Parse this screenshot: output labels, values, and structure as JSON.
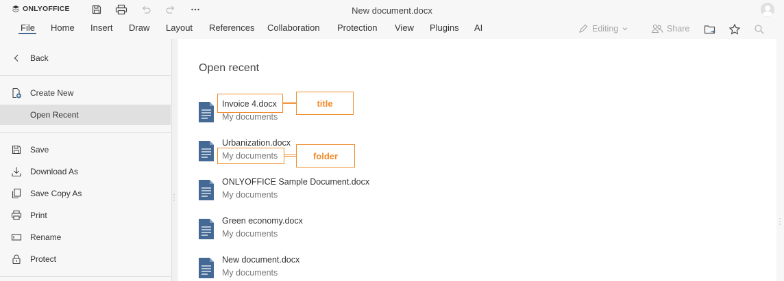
{
  "app": {
    "logo_text": "ONLYOFFICE",
    "document_title": "New document.docx"
  },
  "quick_access": {
    "icons": [
      "save-icon",
      "print-icon",
      "undo-icon",
      "redo-icon",
      "more-icon"
    ]
  },
  "menu": {
    "tabs": [
      "File",
      "Home",
      "Insert",
      "Draw",
      "Layout",
      "References",
      "Collaboration",
      "Protection",
      "View",
      "Plugins",
      "AI"
    ],
    "active_tab": "File",
    "editing_label": "Editing",
    "share_label": "Share"
  },
  "sidebar": {
    "items": [
      {
        "label": "Back",
        "icon": "chevron-left-icon"
      },
      {
        "label": "Create New",
        "icon": "new-document-icon"
      },
      {
        "label": "Open Recent",
        "icon": ""
      },
      {
        "label": "Save",
        "icon": "save-icon"
      },
      {
        "label": "Download As",
        "icon": "download-icon"
      },
      {
        "label": "Save Copy As",
        "icon": "copy-icon"
      },
      {
        "label": "Print",
        "icon": "print-icon"
      },
      {
        "label": "Rename",
        "icon": "rename-icon"
      },
      {
        "label": "Protect",
        "icon": "lock-icon"
      }
    ],
    "selected": "Open Recent"
  },
  "main": {
    "title": "Open recent",
    "files": [
      {
        "name": "Invoice 4.docx",
        "folder": "My documents"
      },
      {
        "name": "Urbanization.docx",
        "folder": "My documents"
      },
      {
        "name": "ONLYOFFICE Sample Document.docx",
        "folder": "My documents"
      },
      {
        "name": "Green economy.docx",
        "folder": "My documents"
      },
      {
        "name": "New document.docx",
        "folder": "My documents"
      }
    ]
  },
  "annotations": {
    "title_label": "title",
    "folder_label": "folder",
    "color": "#ef8b2c"
  },
  "colors": {
    "accent": "#446995",
    "doc_icon": "#446995",
    "selected_bg": "#e0e0e0"
  }
}
